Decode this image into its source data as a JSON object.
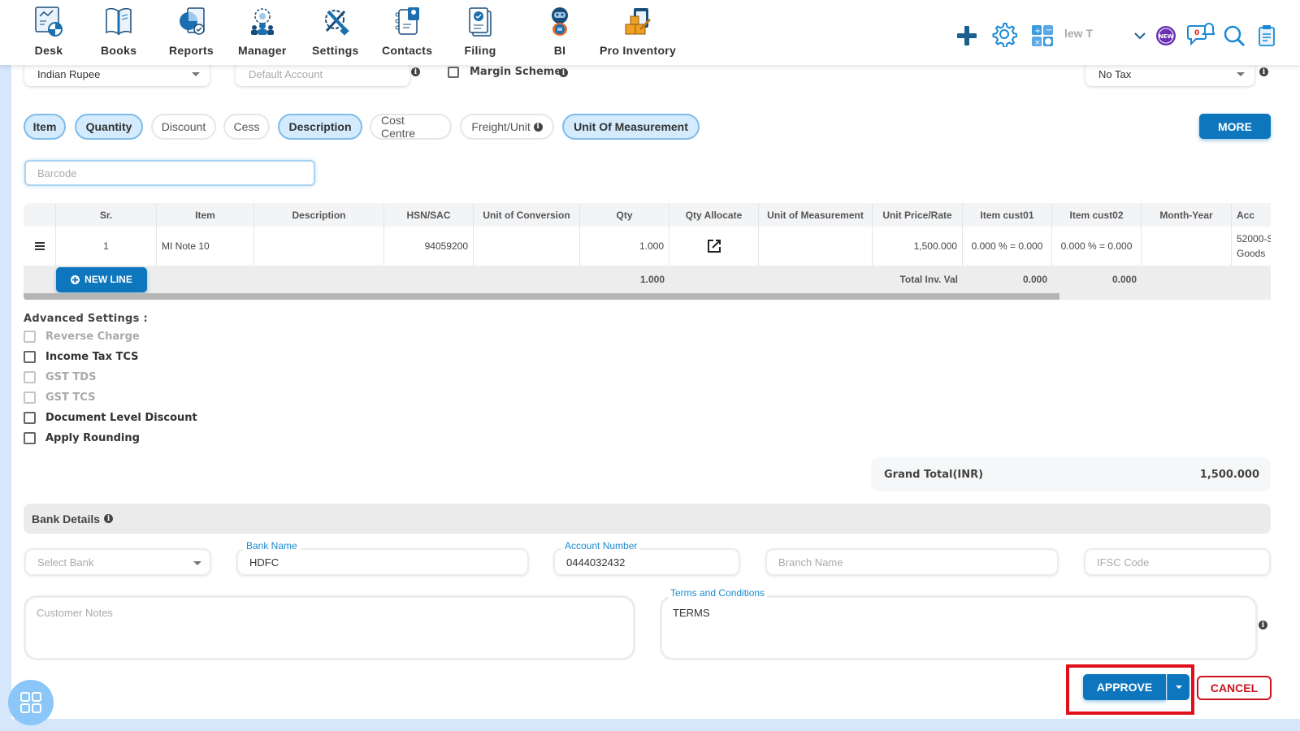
{
  "nav": {
    "items": [
      {
        "label": "Desk",
        "icon": "desk-icon"
      },
      {
        "label": "Books",
        "icon": "books-icon"
      },
      {
        "label": "Reports",
        "icon": "reports-icon"
      },
      {
        "label": "Manager",
        "icon": "manager-icon"
      },
      {
        "label": "Settings",
        "icon": "settings-icon"
      },
      {
        "label": "Contacts",
        "icon": "contacts-icon"
      },
      {
        "label": "Filing",
        "icon": "filing-icon"
      },
      {
        "label": "BI",
        "icon": "bi-robot-icon"
      },
      {
        "label": "Pro Inventory",
        "icon": "pro-inventory-icon"
      }
    ],
    "right": {
      "company_text": "lew T",
      "notification_count": "0",
      "new_badge": "NEW"
    }
  },
  "form": {
    "currency": "Indian Rupee",
    "default_account_placeholder": "Default Account",
    "margin_scheme_label": "Margin Scheme",
    "tax": "No Tax"
  },
  "columns_toggle": [
    {
      "label": "Item",
      "active": true
    },
    {
      "label": "Quantity",
      "active": true
    },
    {
      "label": "Discount",
      "active": false
    },
    {
      "label": "Cess",
      "active": false
    },
    {
      "label": "Description",
      "active": true
    },
    {
      "label": "Cost Centre",
      "active": false
    },
    {
      "label": "Freight/Unit",
      "active": false
    },
    {
      "label": "Unit Of Measurement",
      "active": true
    }
  ],
  "more_label": "MORE",
  "barcode_placeholder": "Barcode",
  "table": {
    "headers": [
      "",
      "Sr.",
      "Item",
      "Description",
      "HSN/SAC",
      "Unit of Conversion",
      "Qty",
      "Qty Allocate",
      "Unit of Measurement",
      "Unit Price/Rate",
      "Item cust01",
      "Item cust02",
      "Month-Year",
      "Acc"
    ],
    "rows": [
      {
        "sr": "1",
        "item": "MI Note 10",
        "description": "",
        "hsn": "94059200",
        "conversion": "",
        "qty": "1.000",
        "uom": "",
        "rate": "1,500.000",
        "cust01": "0.000 % = 0.000",
        "cust02": "0.000 % = 0.000",
        "month_year": "",
        "account_line1": "52000-S",
        "account_line2": "Goods"
      }
    ],
    "footer": {
      "new_line_label": "NEW LINE",
      "qty_total": "1.000",
      "total_inv_label": "Total Inv. Val",
      "cust01_total": "0.000",
      "cust02_total": "0.000"
    }
  },
  "advanced": {
    "title": "Advanced Settings :",
    "options": [
      {
        "label": "Reverse Charge",
        "disabled": true,
        "checked": false
      },
      {
        "label": "Income Tax TCS",
        "disabled": false,
        "checked": false
      },
      {
        "label": "GST TDS",
        "disabled": true,
        "checked": false
      },
      {
        "label": "GST TCS",
        "disabled": true,
        "checked": false
      },
      {
        "label": "Document Level Discount",
        "disabled": false,
        "checked": false
      },
      {
        "label": "Apply Rounding",
        "disabled": false,
        "checked": false
      }
    ]
  },
  "grand_total": {
    "label": "Grand Total(INR)",
    "value": "1,500.000"
  },
  "bank": {
    "title": "Bank Details",
    "select_bank_placeholder": "Select Bank",
    "bank_name_label": "Bank Name",
    "bank_name": "HDFC",
    "account_number_label": "Account Number",
    "account_number": "0444032432",
    "branch_placeholder": "Branch Name",
    "ifsc_placeholder": "IFSC Code"
  },
  "notes": {
    "customer_notes_placeholder": "Customer Notes",
    "terms_label": "Terms and Conditions",
    "terms": "TERMS"
  },
  "actions": {
    "approve": "APPROVE",
    "cancel": "CANCEL"
  },
  "colors": {
    "primary": "#0d76bd",
    "danger": "#c9151f",
    "highlight": "#e0101b",
    "pill_active": "#d3ebfd"
  }
}
